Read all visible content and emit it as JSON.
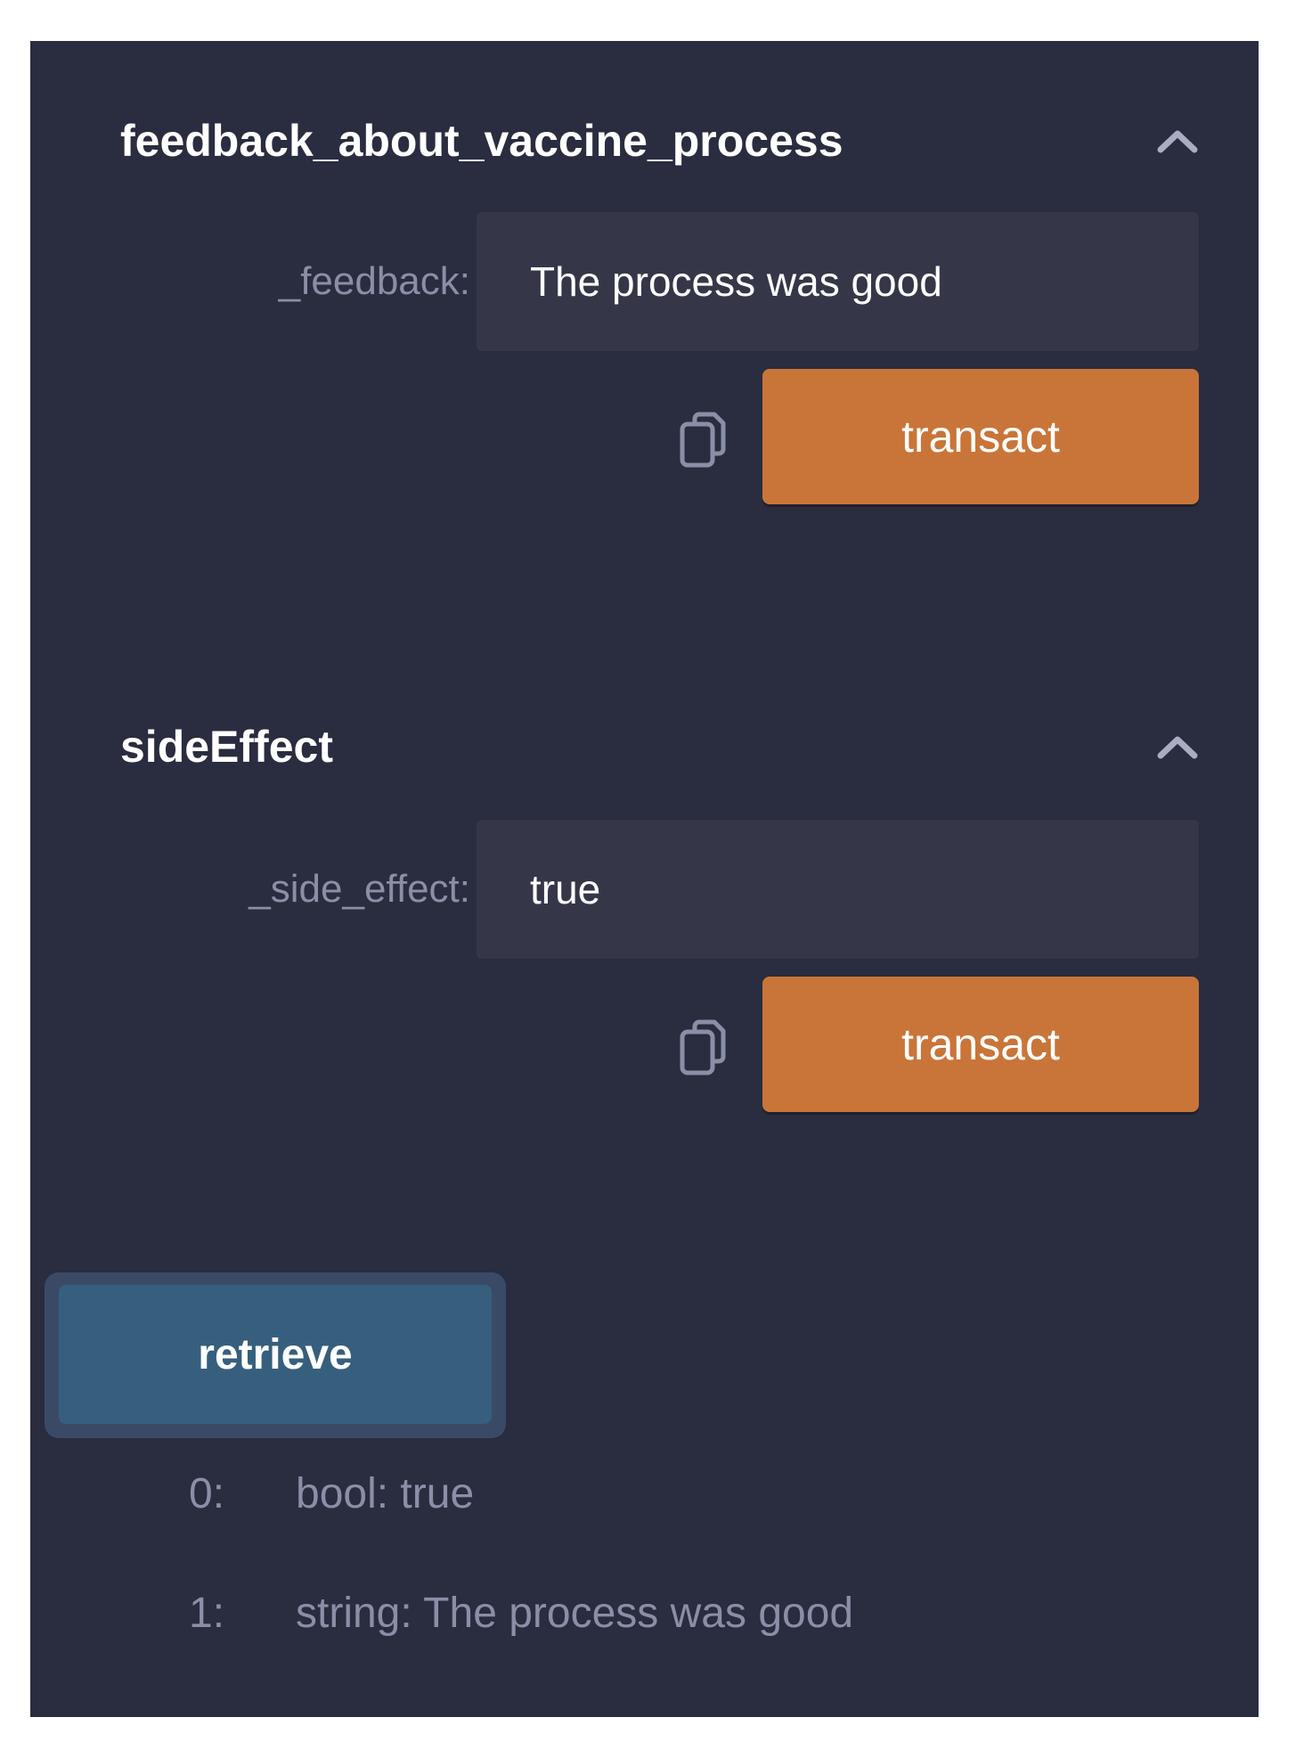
{
  "functions": [
    {
      "name": "feedback_about_vaccine_process",
      "param_label": "_feedback:",
      "param_value": "The process was good",
      "button_label": "transact"
    },
    {
      "name": "sideEffect",
      "param_label": "_side_effect:",
      "param_value": "true",
      "button_label": "transact"
    }
  ],
  "retrieve": {
    "button_label": "retrieve",
    "outputs": [
      {
        "index": "0:",
        "value": "bool: true"
      },
      {
        "index": "1:",
        "value": "string: The process was good"
      }
    ]
  },
  "icons": {
    "collapse": "chevron-up-icon",
    "copy": "copy-icon"
  },
  "colors": {
    "panel_bg": "#2a2c3f",
    "input_bg": "#353749",
    "transact": "#c97539",
    "retrieve": "#365f7e",
    "muted_text": "#8a8fa8"
  }
}
